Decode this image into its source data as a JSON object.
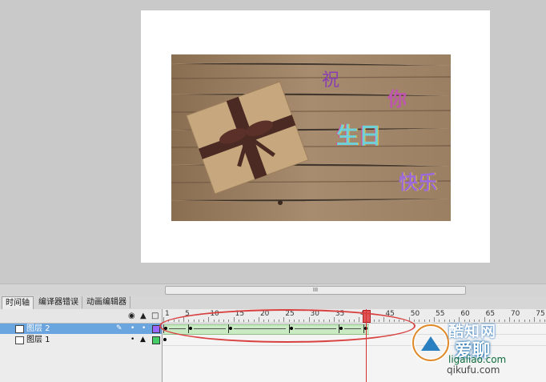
{
  "stage": {
    "greeting": [
      {
        "text": "祝",
        "color": "#8a3fb0"
      },
      {
        "text": "你",
        "color": "#c055b0"
      },
      {
        "text": "生日",
        "color": "#6fd0d8"
      },
      {
        "text": "快乐",
        "color": "#9a6ad8"
      }
    ]
  },
  "scrollbar": {
    "grip": "III"
  },
  "tabs": [
    "时间轴",
    "编译器错误",
    "动画编辑器"
  ],
  "layer_header_icons": {
    "eye": "eye-icon",
    "lock": "lock-icon",
    "outline": "outline-icon"
  },
  "ruler": {
    "labels": [
      "1",
      "5",
      "10",
      "15",
      "20",
      "25",
      "30",
      "35",
      "40",
      "45",
      "50",
      "55",
      "60",
      "65",
      "70",
      "75"
    ]
  },
  "layers": [
    {
      "name": "图层 2",
      "selected": true,
      "color": "#9966ff"
    },
    {
      "name": "图层 1",
      "selected": false,
      "color": "#44cc66"
    }
  ],
  "timeline": {
    "current_frame": 41,
    "tween_end_frame": 41,
    "keyframes": [
      1,
      6,
      14,
      26,
      36,
      41
    ]
  },
  "watermark": {
    "line1": "酷知网",
    "line2": "爱聊",
    "line3": "ligaliao.com",
    "line4": "qikufu.com"
  },
  "colors": {
    "selected_layer": "#6aa5df",
    "tween": "#c9eac3",
    "playhead": "#d83030",
    "annotation": "#d94040"
  }
}
